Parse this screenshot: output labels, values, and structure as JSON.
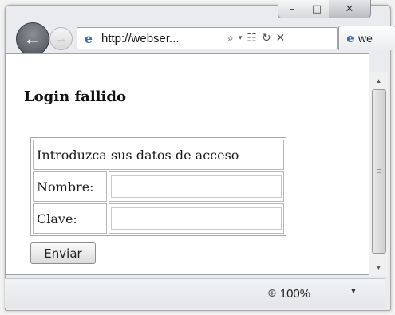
{
  "browser": {
    "window_controls": {
      "minimize_icon": "minimize-icon",
      "maximize_icon": "maximize-icon",
      "close_icon": "close-icon"
    },
    "address": {
      "url": "http://webser..."
    },
    "tab": {
      "label": "we"
    },
    "zoom_label": "100%"
  },
  "page": {
    "title": "Login fallido",
    "form": {
      "header": "Introduzca sus datos de acceso",
      "name_label": "Nombre:",
      "name_value": "",
      "password_label": "Clave:",
      "password_value": "",
      "submit_label": "Enviar"
    }
  },
  "colors": {
    "window_frame": "#e9ebee",
    "back_button": "#4a4f55",
    "ie_logo": "#3a6fb3"
  }
}
